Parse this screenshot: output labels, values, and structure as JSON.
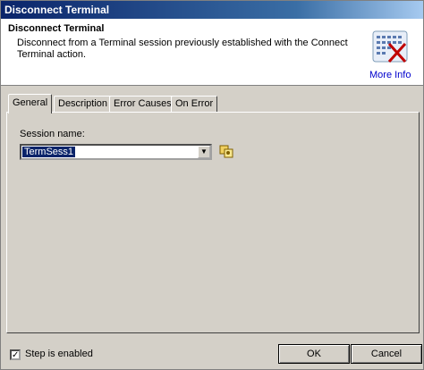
{
  "window": {
    "title": "Disconnect Terminal"
  },
  "header": {
    "title": "Disconnect Terminal",
    "description": "Disconnect from a Terminal session previously established with the Connect Terminal action.",
    "more_info_label": "More Info"
  },
  "tabs": [
    {
      "label": "General",
      "active": true
    },
    {
      "label": "Description",
      "active": false
    },
    {
      "label": "Error Causes",
      "active": false
    },
    {
      "label": "On Error",
      "active": false
    }
  ],
  "general": {
    "session_name_label": "Session name:",
    "session_name_value": "TermSess1"
  },
  "footer": {
    "step_enabled_label": "Step is enabled",
    "step_enabled_checked": true,
    "ok_label": "OK",
    "cancel_label": "Cancel"
  },
  "colors": {
    "titlebar": "#0a246a",
    "face": "#d4d0c8",
    "link": "#0000cc",
    "selection": "#0a246a"
  },
  "icons": [
    "terminal-disconnect-icon",
    "dropdown-arrow-icon",
    "session-variable-icon",
    "checkmark-icon"
  ]
}
